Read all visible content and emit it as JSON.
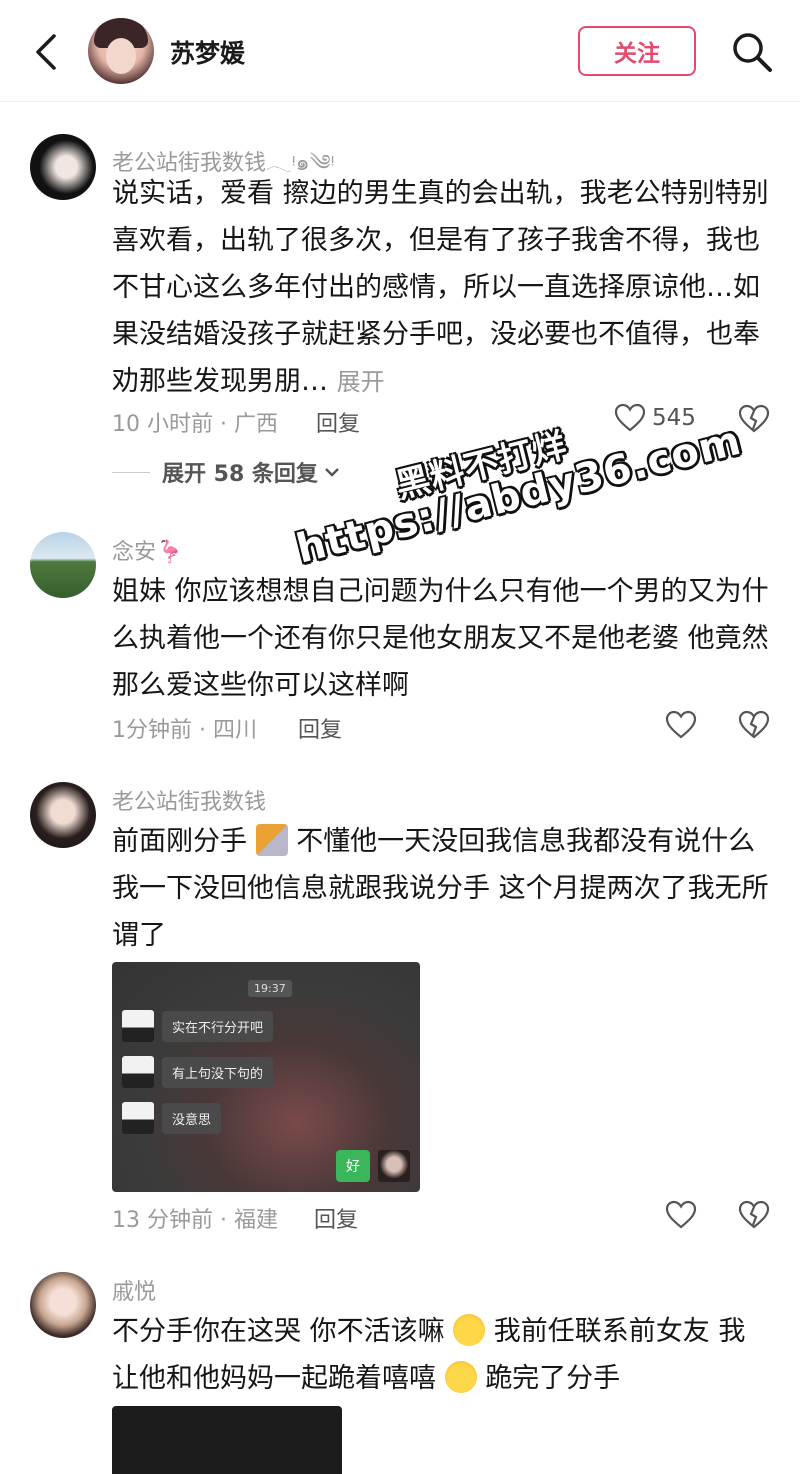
{
  "header": {
    "name": "苏梦媛",
    "follow_label": "关注"
  },
  "watermark": {
    "line1": "黑料不打烊",
    "line2": "https://abdy36.com"
  },
  "comments": [
    {
      "user": "老公站街我数钱𓂃ᵎ๑༄ᵎ",
      "text": "说实话，爱看 擦边的男生真的会出轨，我老公特别特别喜欢看，出轨了很多次，但是有了孩子我舍不得，我也不甘心这么多年付出的感情，所以一直选择原谅他…如果没结婚没孩子就赶紧分手吧，没必要也不值得，也奉劝那些发现男朋…",
      "more_label": "展开",
      "meta": "10 小时前 · 广西",
      "reply_label": "回复",
      "likes": "545",
      "expand_label": "展开 58 条回复"
    },
    {
      "user": "念安🦩",
      "text": "姐妹 你应该想想自己问题为什么只有他一个男的又为什么执着他一个还有你只是他女朋友又不是他老婆 他竟然那么爱这些你可以这样啊",
      "meta": "1分钟前 · 四川",
      "reply_label": "回复"
    },
    {
      "user": "老公站街我数钱",
      "text_a": "前面刚分手",
      "text_b": "不懂他一天没回我信息我都没有说什么 我一下没回他信息就跟我说分手 这个月提两次了我无所谓了",
      "meta": "13 分钟前 · 福建",
      "reply_label": "回复",
      "chat": {
        "time": "19:37",
        "msg1": "实在不行分开吧",
        "msg2": "有上句没下句的",
        "msg3": "没意思",
        "reply": "好"
      }
    },
    {
      "user": "戚悦",
      "text_a": "不分手你在这哭 你不活该嘛",
      "text_b": "我前任联系前女友 我让他和他妈妈一起跪着嘻嘻",
      "text_c": "跪完了分手"
    }
  ],
  "colors": {
    "accent": "#e54a6e",
    "secondary_text": "#9a9a9a"
  }
}
